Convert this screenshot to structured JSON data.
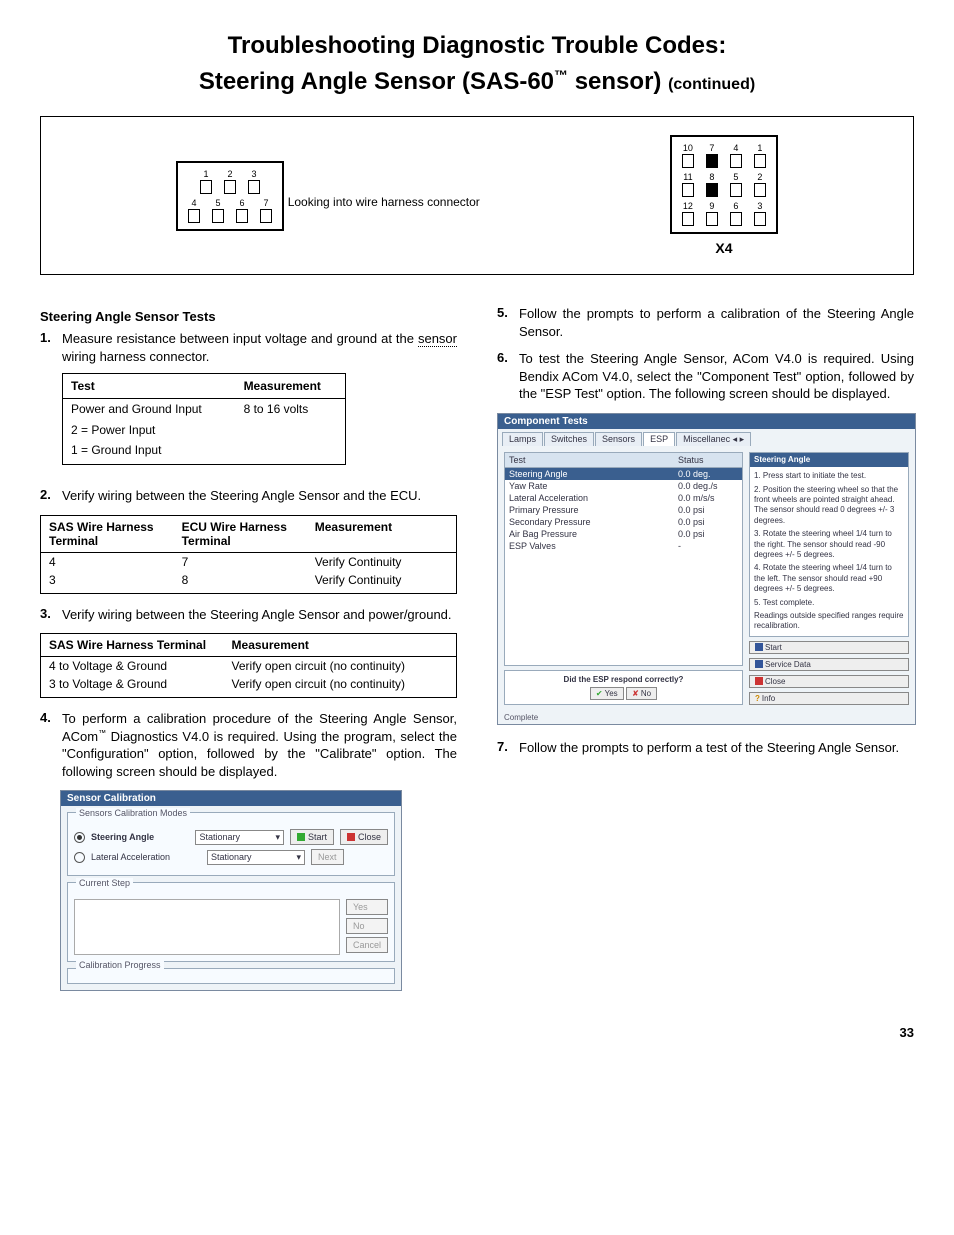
{
  "title_line1": "Troubleshooting Diagnostic Trouble Codes:",
  "title_line2_a": "Steering Angle Sensor (SAS-60",
  "title_line2_tm": "™",
  "title_line2_b": " sensor)",
  "continued": "(continued)",
  "diagram": {
    "left_caption": "Looking into wire harness connector",
    "left_top": [
      "1",
      "2",
      "3"
    ],
    "left_bottom": [
      "4",
      "5",
      "6",
      "7"
    ],
    "right_rows": [
      [
        "10",
        "7",
        "4",
        "1"
      ],
      [
        "11",
        "8",
        "5",
        "2"
      ],
      [
        "12",
        "9",
        "6",
        "3"
      ]
    ],
    "right_label": "X4"
  },
  "left_col": {
    "section_head": "Steering Angle Sensor Tests",
    "step1_body_a": "Measure resistance between input voltage and ground at the ",
    "step1_underline": "sensor",
    "step1_body_b": " wiring harness connector.",
    "table1": {
      "h1": "Test",
      "h2": "Measurement",
      "r1c1": "Power and Ground Input",
      "r1c2": "8 to 16 volts",
      "r2c1": "2 = Power Input",
      "r3c1": "1 = Ground Input"
    },
    "step2_body": "Verify wiring between the Steering Angle Sensor and the ECU.",
    "table2": {
      "h1": "SAS Wire Harness Terminal",
      "h2": "ECU Wire Harness Terminal",
      "h3": "Measurement",
      "rows": [
        {
          "c1": "4",
          "c2": "7",
          "c3": "Verify Continuity"
        },
        {
          "c1": "3",
          "c2": "8",
          "c3": "Verify Continuity"
        }
      ]
    },
    "step3_body": "Verify wiring between the Steering Angle Sensor and power/ground.",
    "table3": {
      "h1": "SAS Wire Harness Terminal",
      "h2": "Measurement",
      "rows": [
        {
          "c1": "4  to Voltage & Ground",
          "c2": "Verify open circuit (no continuity)"
        },
        {
          "c1": "3  to Voltage & Ground",
          "c2": "Verify open circuit (no continuity)"
        }
      ]
    },
    "step4_body_a": "To perform a calibration procedure of the Steering Angle Sensor, ACom",
    "step4_tm": "™",
    "step4_body_b": " Diagnostics V4.0 is required.  Using the program, select the \"Configuration\" option, followed by the \"Calibrate\" option.  The following screen should be displayed.",
    "screenshot1": {
      "title": "Sensor Calibration",
      "group1_legend": "Sensors Calibration Modes",
      "opt1": "Steering Angle",
      "opt2": "Lateral Acceleration",
      "sel_val": "Stationary",
      "btn_start": "Start",
      "btn_close": "Close",
      "btn_next": "Next",
      "group2_legend": "Current Step",
      "btn_yes": "Yes",
      "btn_no": "No",
      "btn_cancel": "Cancel",
      "group3_legend": "Calibration Progress"
    }
  },
  "right_col": {
    "step5_body": "Follow the prompts to perform a calibration of the Steering Angle Sensor.",
    "step6_body": "To test the Steering Angle Sensor, ACom V4.0 is required. Using Bendix ACom V4.0, select the \"Component Test\" option, followed by the \"ESP Test\" option. The following screen should be displayed.",
    "screenshot2": {
      "title": "Component Tests",
      "tabs": [
        "Lamps",
        "Switches",
        "Sensors",
        "ESP",
        "Miscellanec"
      ],
      "table_head": [
        "Test",
        "Status"
      ],
      "table_rows": [
        [
          "Steering Angle",
          "0.0 deg."
        ],
        [
          "Yaw Rate",
          "0.0 deg./s"
        ],
        [
          "Lateral Acceleration",
          "0.0 m/s/s"
        ],
        [
          "Primary Pressure",
          "0.0 psi"
        ],
        [
          "Secondary Pressure",
          "0.0 psi"
        ],
        [
          "Air Bag Pressure",
          "0.0 psi"
        ],
        [
          "ESP Valves",
          "-"
        ]
      ],
      "panel_title": "Steering Angle",
      "panel_lines": [
        "1. Press start to initiate the test.",
        "2. Position the steering wheel so that the front wheels are pointed straight ahead. The sensor should read 0 degrees +/- 3 degrees.",
        "3. Rotate the steering wheel 1/4 turn to the right. The sensor should read -90 degrees +/- 5 degrees.",
        "4. Rotate the steering wheel 1/4 turn to the left. The sensor should read +90 degrees +/- 5 degrees.",
        "5. Test complete.",
        "Readings outside specified ranges require recalibration."
      ],
      "question": "Did the ESP respond correctly?",
      "btn_yes": "Yes",
      "btn_no": "No",
      "btn_start": "Start",
      "btn_service": "Service Data",
      "btn_close": "Close",
      "btn_info": "Info",
      "footer": "Complete"
    },
    "step7_body": "Follow the prompts to perform a test of the Steering Angle Sensor."
  },
  "page_number": "33"
}
